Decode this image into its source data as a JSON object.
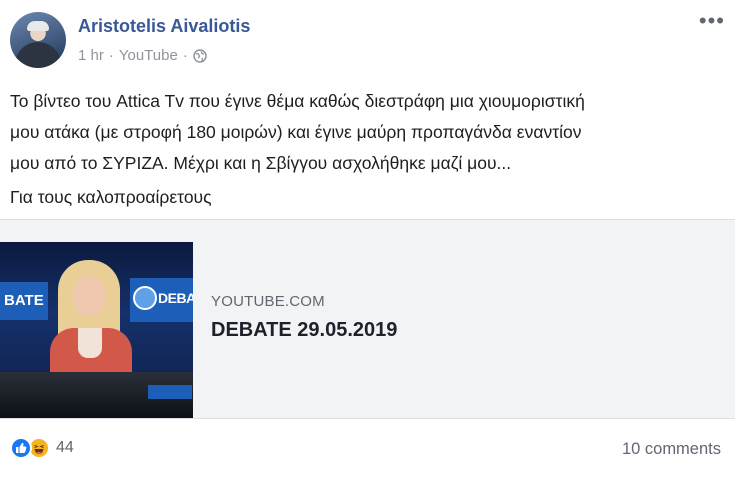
{
  "post": {
    "author": "Aristotelis Aivaliotis",
    "time": "1 hr",
    "separator": "·",
    "source": "YouTube",
    "privacy_icon": "globe-icon",
    "more_icon": "more-options-icon",
    "text_lines": [
      "Το βίντεο του Attica Tv που έγινε θέμα καθώς διεστράφη μια χιουμοριστική",
      "μου ατάκα (με στροφή 180 μοιρών) και έγινε μαύρη προπαγάνδα εναντίον",
      "μου από το ΣΥΡΙΖΑ. Μέχρι και η Σβίγγου ασχολήθηκε μαζί μου..."
    ],
    "text_second_paragraph": "Για τους καλοπροαίρετους"
  },
  "link_preview": {
    "domain": "YOUTUBE.COM",
    "title": "DEBATE 29.05.2019",
    "thumbnail_labels": {
      "left": "BATE",
      "right": "DEBATE"
    }
  },
  "footer": {
    "reaction_icons": [
      "like-icon",
      "haha-icon"
    ],
    "reaction_count": "44",
    "comments": "10 comments"
  },
  "colors": {
    "author": "#385898",
    "meta": "#90949c",
    "card_bg": "#f2f3f5",
    "like": "#1877f2",
    "haha": "#f7b125"
  }
}
